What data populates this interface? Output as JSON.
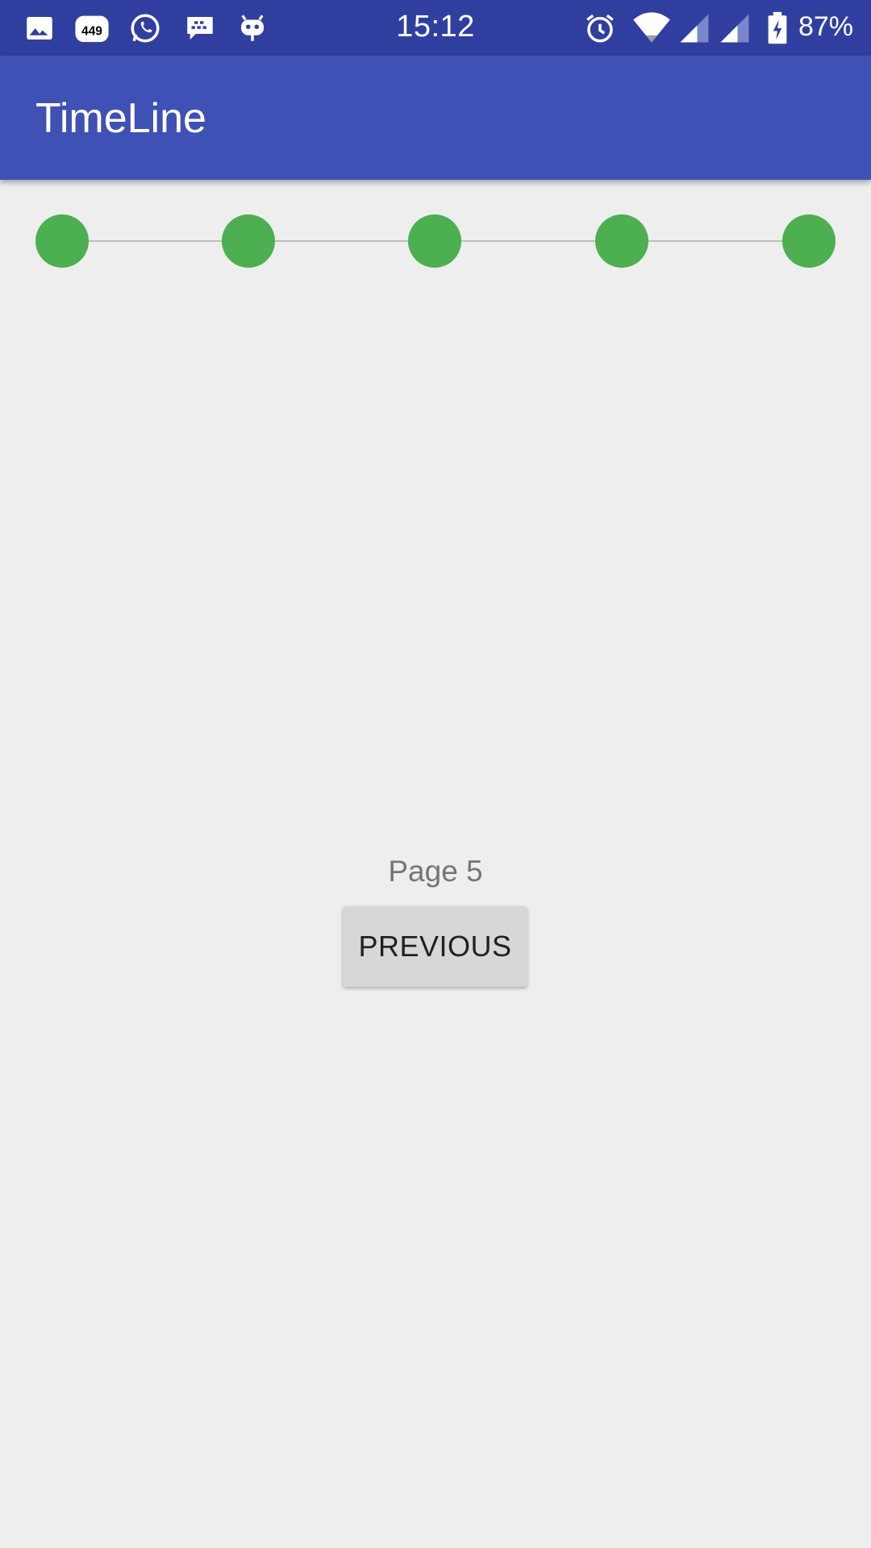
{
  "status_bar": {
    "time": "15:12",
    "battery_percent": "87%",
    "notification_icons": [
      "image-icon",
      "badge-449-icon",
      "whatsapp-icon",
      "bbm-icon",
      "cyanogen-icon"
    ],
    "notification_badge_count": "449",
    "system_icons": [
      "alarm-icon",
      "wifi-icon",
      "signal-icon",
      "signal-icon",
      "battery-charging-icon"
    ],
    "background_color": "#303f9f"
  },
  "app_bar": {
    "title": "TimeLine",
    "background_color": "#3f51b5"
  },
  "timeline": {
    "steps": [
      {
        "state": "completed"
      },
      {
        "state": "completed"
      },
      {
        "state": "completed"
      },
      {
        "state": "completed"
      },
      {
        "state": "completed"
      }
    ],
    "dot_color": "#4caf50",
    "line_color": "#bdbdbd"
  },
  "content": {
    "page_label": "Page 5",
    "previous_button_label": "PREVIOUS"
  }
}
